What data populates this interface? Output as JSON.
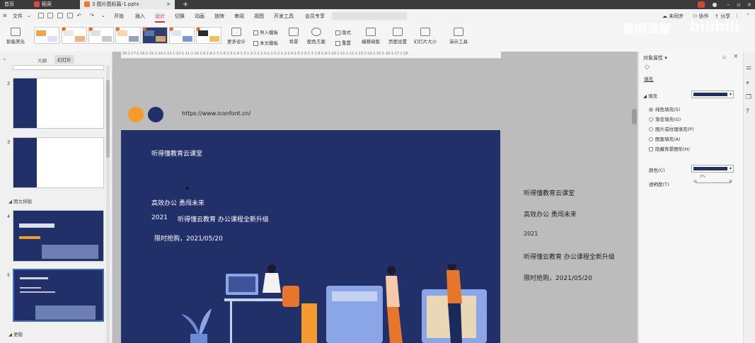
{
  "titlebar": {
    "tabs": [
      {
        "label": "首页",
        "color": "#3b3b3b"
      },
      {
        "label": "稻壳",
        "color": "#d94a3a"
      },
      {
        "label": "3 图片图标篇-1.pptx",
        "color": "#e87a2b"
      }
    ],
    "add_tab": "+"
  },
  "menubar": {
    "file_label": "文件",
    "items": [
      "开始",
      "插入",
      "设计",
      "切换",
      "动画",
      "放映",
      "审阅",
      "视图",
      "开发工具",
      "会员专享"
    ],
    "active": "设计",
    "right": {
      "sync": "未同步",
      "collab": "协作",
      "share": "分享"
    }
  },
  "ribbon": {
    "smart_beautify": "智能美化",
    "more_design": "更多设计",
    "import_template": "导入模板",
    "text_template": "本文模板",
    "background": "背景",
    "color_scheme": "配色方案",
    "layout": "版式",
    "reset": "重置",
    "edit_master": "编辑母版",
    "page_setup": "页面设置",
    "slide_size": "幻灯片大小",
    "present_tools": "演示工具"
  },
  "leftpanel": {
    "tab_outline": "大纲",
    "tab_slides": "幻灯片",
    "slide_numbers": [
      "2",
      "3",
      "4",
      "5"
    ],
    "sections": [
      "图文排版",
      "更版"
    ]
  },
  "ruler_text": "·18·1·17·1·16·1·15·1·14·1·13·1·12·1·11·1·10·1·9·1·8·1·7·1·6·1·5·1·4·1·3·1·2·1·1·1·0·1·1·1·2·1·3·1·4·1·5·1·6·1·7·1·8·1·9·1·10·1·11·1·12·1·13·1·14·1·15·1·16·1·17·1·18·",
  "canvas": {
    "url_text": "https://www.iconfont.cn/",
    "circle_orange": "#f59a2c",
    "circle_navy": "#22306a",
    "slide": {
      "title": "听得懂教育云课堂",
      "slogan": "高效办公 勇闯未来",
      "year": "2021",
      "upgrade": "听得懂云教育 办公课程全新升级",
      "promo": "限时抢购，2021/05/20",
      "bg_color": "#22306a"
    },
    "outside": {
      "line1": "听得懂教育云课堂",
      "line2": "高效办公 勇闯未来",
      "line3": "2021",
      "line4": "听得懂云教育 办公课程全新升级",
      "line5": "限时抢购，2021/05/20"
    }
  },
  "rightpanel": {
    "title": "对象属性",
    "fill_tab": "填充",
    "fill_section": "填充",
    "fill_color": "#22306a",
    "options": [
      {
        "label": "纯色填充(S)",
        "selected": true
      },
      {
        "label": "渐变填充(G)",
        "selected": false
      },
      {
        "label": "图片或纹理填充(P)",
        "selected": false
      },
      {
        "label": "图案填充(A)",
        "selected": false
      }
    ],
    "hide_bg": "隐藏背景图形(H)",
    "color_label": "颜色(C)",
    "transparency_label": "透明度(T)",
    "transparency_value": "0%"
  },
  "watermark": {
    "channel": "吴明课堂",
    "platform": "bilibili"
  }
}
